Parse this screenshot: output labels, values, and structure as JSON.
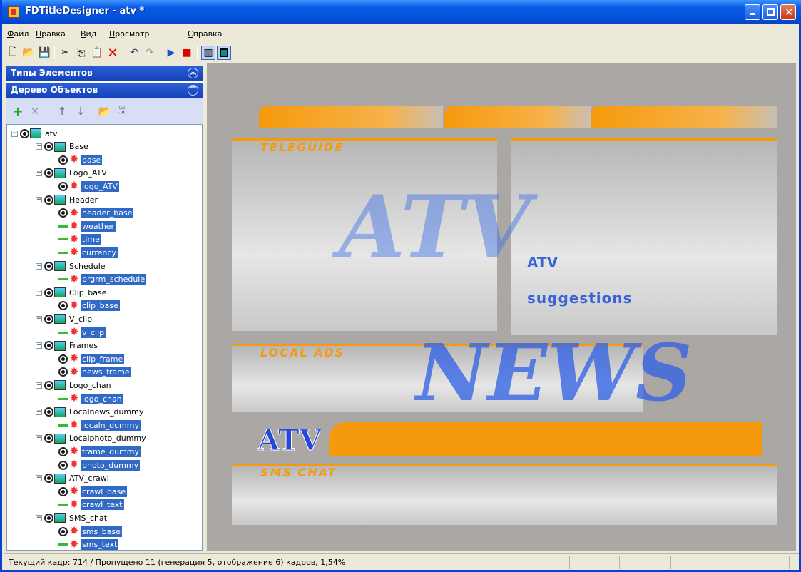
{
  "window": {
    "title": "FDTitleDesigner - atv *"
  },
  "menu": [
    "Файл",
    "Правка",
    "Вид",
    "Просмотр",
    "Справка"
  ],
  "toolbar": {
    "icons": [
      "new-icon",
      "open-icon",
      "save-icon",
      "cut-icon",
      "copy-icon",
      "paste-icon",
      "delete-icon",
      "undo-icon",
      "redo-icon",
      "play-icon",
      "stop-icon",
      "safe-area-icon",
      "frame-icon"
    ]
  },
  "panels": {
    "types_title": "Типы Элементов",
    "tree_title": "Дерево Объектов"
  },
  "tree": [
    {
      "level": 0,
      "text": "atv",
      "kind": "root",
      "sel": false
    },
    {
      "level": 1,
      "text": "Base",
      "kind": "group",
      "sel": false
    },
    {
      "level": 2,
      "text": "base",
      "kind": "eye",
      "sel": true
    },
    {
      "level": 1,
      "text": "Logo_ATV",
      "kind": "group",
      "sel": false
    },
    {
      "level": 2,
      "text": "logo_ATV",
      "kind": "eye",
      "sel": true
    },
    {
      "level": 1,
      "text": "Header",
      "kind": "group",
      "sel": false
    },
    {
      "level": 2,
      "text": "header_base",
      "kind": "eye",
      "sel": true
    },
    {
      "level": 2,
      "text": "weather",
      "kind": "dash",
      "sel": true
    },
    {
      "level": 2,
      "text": "time",
      "kind": "dash",
      "sel": true
    },
    {
      "level": 2,
      "text": "currency",
      "kind": "dash",
      "sel": true
    },
    {
      "level": 1,
      "text": "Schedule",
      "kind": "group",
      "sel": false
    },
    {
      "level": 2,
      "text": "prgrm_schedule",
      "kind": "dash",
      "sel": true
    },
    {
      "level": 1,
      "text": "Clip_base",
      "kind": "group",
      "sel": false
    },
    {
      "level": 2,
      "text": "clip_base",
      "kind": "eye",
      "sel": true
    },
    {
      "level": 1,
      "text": "V_clip",
      "kind": "group",
      "sel": false
    },
    {
      "level": 2,
      "text": "v_clip",
      "kind": "dash",
      "sel": true
    },
    {
      "level": 1,
      "text": "Frames",
      "kind": "group",
      "sel": false
    },
    {
      "level": 2,
      "text": "clip_frame",
      "kind": "eye",
      "sel": true
    },
    {
      "level": 2,
      "text": "news_frame",
      "kind": "eye",
      "sel": true
    },
    {
      "level": 1,
      "text": "Logo_chan",
      "kind": "group",
      "sel": false
    },
    {
      "level": 2,
      "text": "logo_chan",
      "kind": "dash",
      "sel": true
    },
    {
      "level": 1,
      "text": "Localnews_dummy",
      "kind": "group",
      "sel": false
    },
    {
      "level": 2,
      "text": "localn_dummy",
      "kind": "dash",
      "sel": true
    },
    {
      "level": 1,
      "text": "Localphoto_dummy",
      "kind": "group",
      "sel": false
    },
    {
      "level": 2,
      "text": "frame_dummy",
      "kind": "eye",
      "sel": true
    },
    {
      "level": 2,
      "text": "photo_dummy",
      "kind": "eye",
      "sel": true
    },
    {
      "level": 1,
      "text": "ATV_crawl",
      "kind": "group",
      "sel": false
    },
    {
      "level": 2,
      "text": "crawl_base",
      "kind": "eye",
      "sel": true
    },
    {
      "level": 2,
      "text": "crawl_text",
      "kind": "dash",
      "sel": true
    },
    {
      "level": 1,
      "text": "SMS_chat",
      "kind": "group",
      "sel": false
    },
    {
      "level": 2,
      "text": "sms_base",
      "kind": "eye",
      "sel": true
    },
    {
      "level": 2,
      "text": "sms_text",
      "kind": "dash",
      "sel": true
    }
  ],
  "preview": {
    "teleguide": "TELEGUIDE",
    "local_ads": "LOCAL ADS",
    "sms_chat": "SMS CHAT",
    "atv_wm": "ATV",
    "news_wm": "NEWS",
    "atv_line": "ATV",
    "suggestions": "suggestions",
    "logo": "ATV"
  },
  "status": {
    "text": "Текущий кадр: 714 / Пропущено 11 (генерация 5, отображение 6) кадров,  1,54%"
  }
}
